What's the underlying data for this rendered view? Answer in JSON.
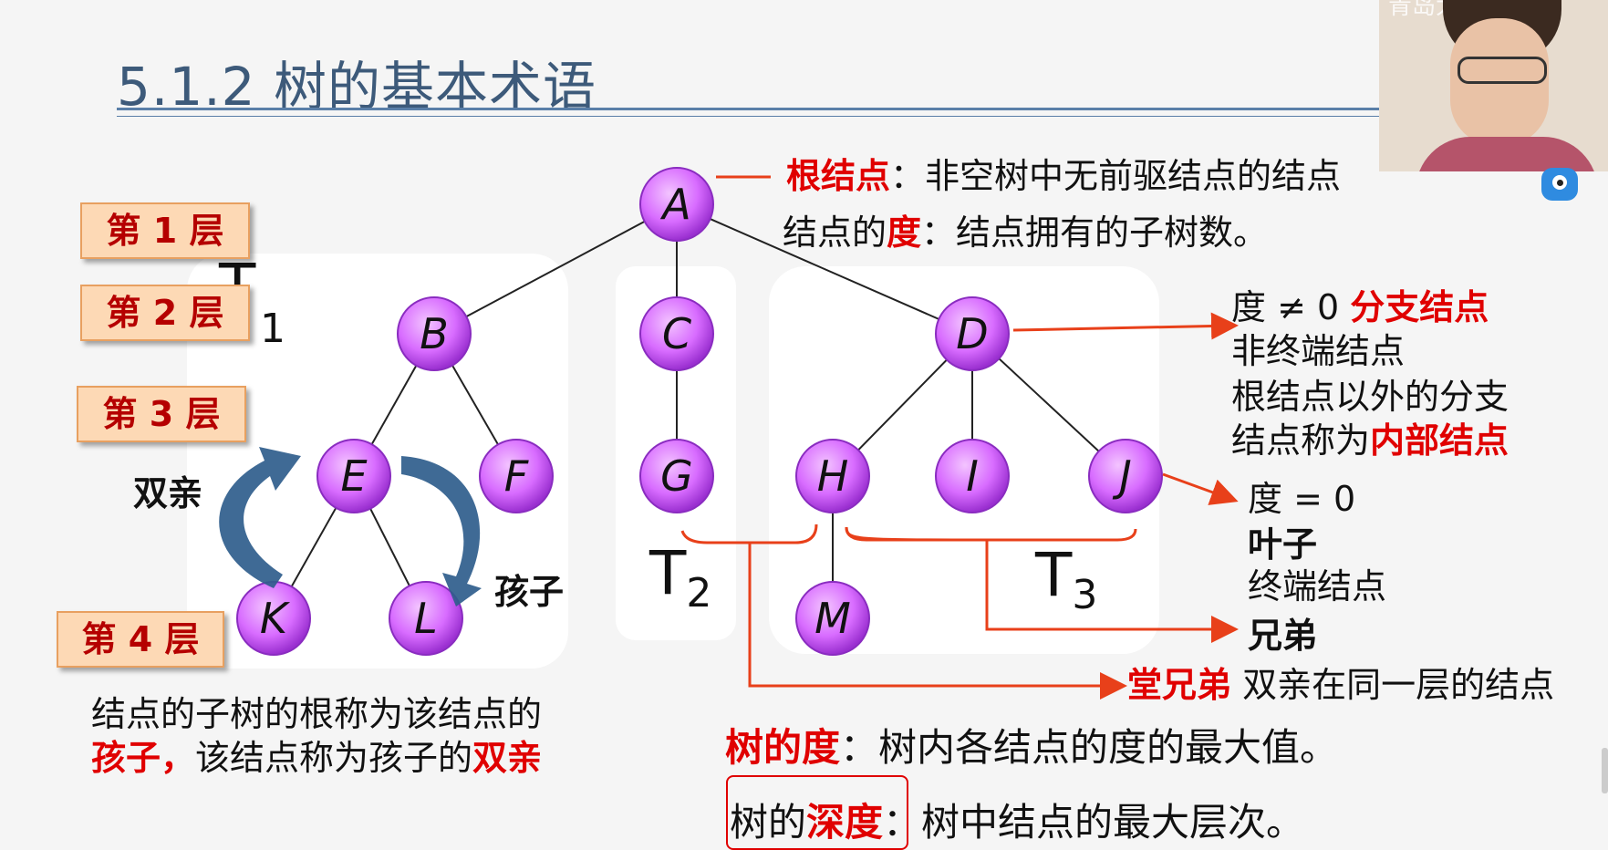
{
  "slide": {
    "title": "5.1.2 树的基本术语",
    "tree_labels": {
      "t1": "T",
      "t1_sub": "1",
      "t2": "T",
      "t2_sub": "2",
      "t3": "T",
      "t3_sub": "3"
    },
    "levels": [
      "第 1 层",
      "第 2 层",
      "第 3 层",
      "第 4 层"
    ],
    "nodes": [
      "A",
      "B",
      "C",
      "D",
      "E",
      "F",
      "G",
      "H",
      "I",
      "J",
      "K",
      "L",
      "M"
    ],
    "left_labels": {
      "parent": "双亲",
      "child": "孩子"
    },
    "root_def": {
      "term": "根结点",
      "sep": "：",
      "desc": "非空树中无前驱结点的结点"
    },
    "degree_def": {
      "prefix": "结点的",
      "term": "度",
      "sep": "：",
      "desc": "结点拥有的子树数。"
    },
    "branch_block": {
      "cond": "度 ≠ 0",
      "term": "分支结点",
      "alt": "非终端结点",
      "line3": "根结点以外的分支",
      "line4_prefix": "结点称为",
      "line4_term": "内部结点"
    },
    "leaf_block": {
      "cond": "度 = 0",
      "term": "叶子",
      "alt": "终端结点"
    },
    "sibling": "兄弟",
    "cousin": {
      "term": "堂兄弟",
      "desc": "双亲在同一层的结点"
    },
    "child_def": {
      "line1": "结点的子树的根称为该结点的",
      "term_child": "孩子，",
      "mid": "该结点称为孩子的",
      "term_parent": "双亲"
    },
    "tree_degree": {
      "term": "树的度",
      "sep": "：",
      "desc": "树内各结点的度的最大值。"
    },
    "tree_depth": {
      "prefix": "树的",
      "term": "深度",
      "sep": "：",
      "desc": "树中结点的最大层次。"
    },
    "webcam_text": "青岛大学 · 王卓"
  },
  "colors": {
    "node_fill": "#d86cff",
    "red": "#e00000",
    "orange": "#d86b00",
    "title": "#3d5a7a",
    "arrow_blue": "#2f5d8c"
  }
}
